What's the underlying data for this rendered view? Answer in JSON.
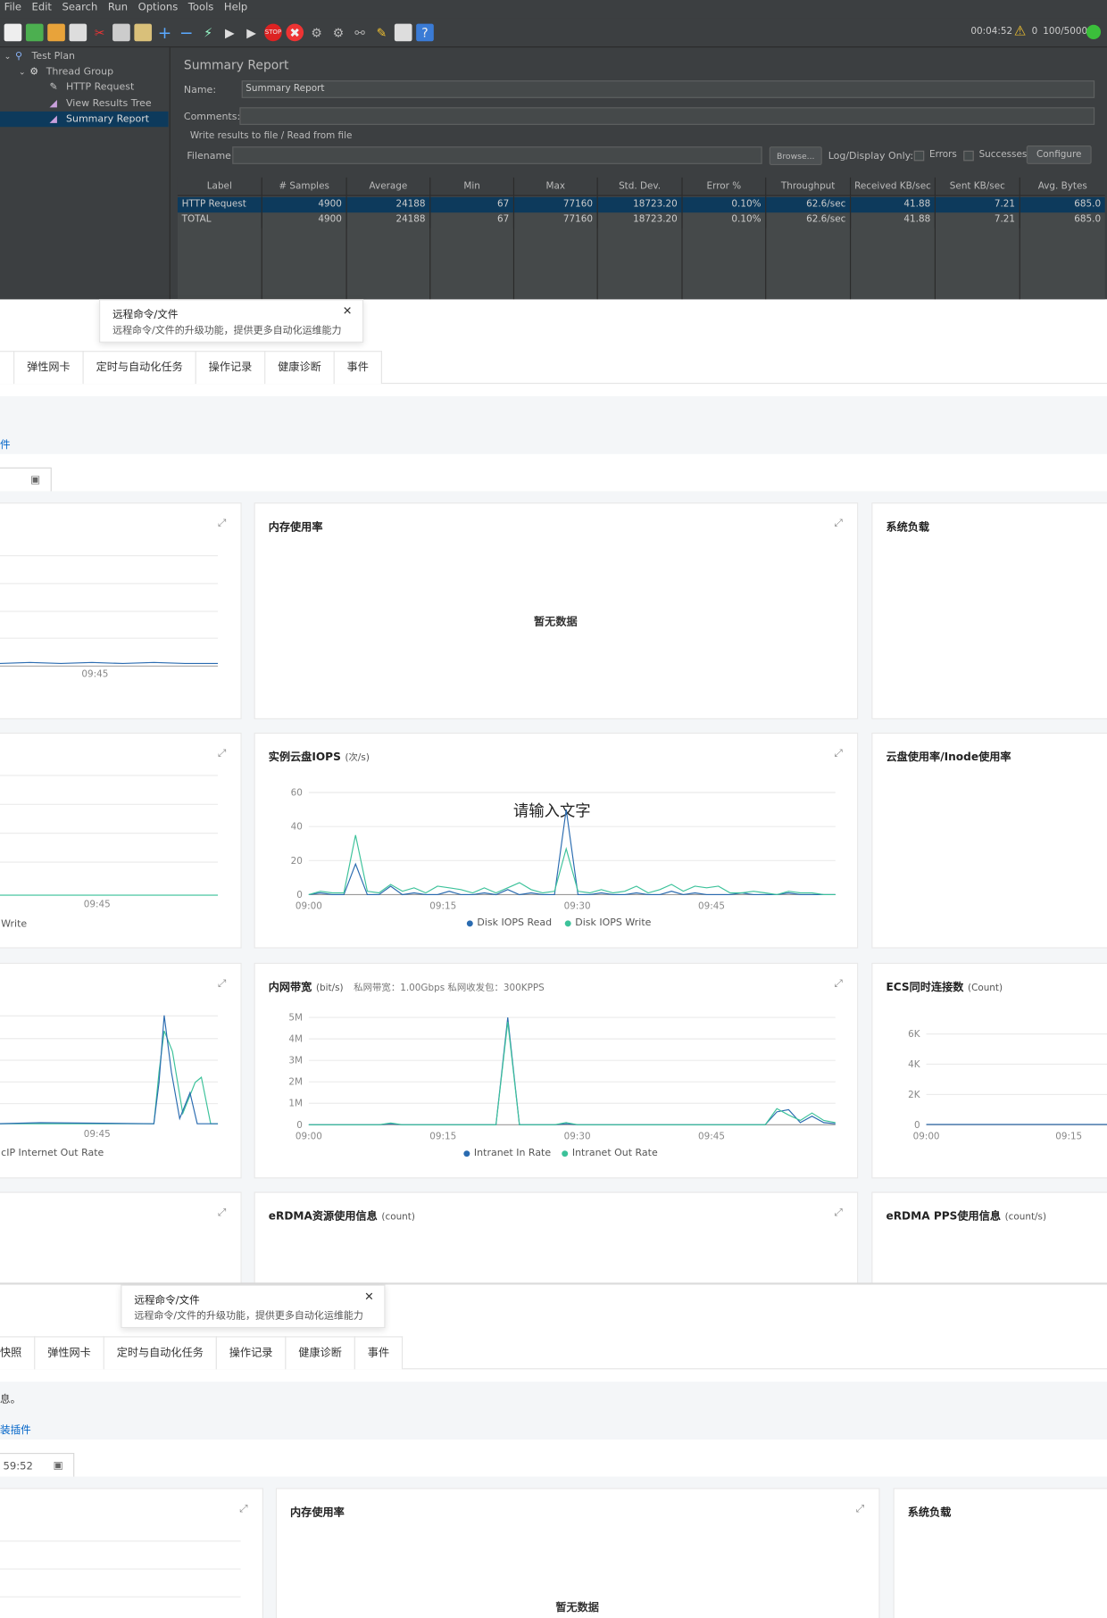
{
  "jmeter": {
    "menu": [
      "File",
      "Edit",
      "Search",
      "Run",
      "Options",
      "Tools",
      "Help"
    ],
    "status": {
      "elapsed": "00:04:52",
      "warnings": "0",
      "threads": "100/5000"
    },
    "tree": [
      "Test Plan",
      "Thread Group",
      "HTTP Request",
      "View Results Tree",
      "Summary Report"
    ],
    "panel_title": "Summary Report",
    "name_label": "Name:",
    "name_value": "Summary Report",
    "comments_label": "Comments:",
    "write_results": "Write results to file / Read from file",
    "filename_label": "Filename",
    "browse": "Browse...",
    "log_only": "Log/Display Only:",
    "errors": "Errors",
    "successes": "Successes",
    "configure": "Configure",
    "columns": [
      "Label",
      "# Samples",
      "Average",
      "Min",
      "Max",
      "Std. Dev.",
      "Error %",
      "Throughput",
      "Received KB/sec",
      "Sent KB/sec",
      "Avg. Bytes"
    ],
    "rows": [
      [
        "HTTP Request",
        "4900",
        "24188",
        "67",
        "77160",
        "18723.20",
        "0.10%",
        "62.6/sec",
        "41.88",
        "7.21",
        "685.0"
      ],
      [
        "TOTAL",
        "4900",
        "24188",
        "67",
        "77160",
        "18723.20",
        "0.10%",
        "62.6/sec",
        "41.88",
        "7.21",
        "685.0"
      ]
    ]
  },
  "console": {
    "tip_title": "远程命令/文件",
    "tip_desc": "远程命令/文件的升级功能，提供更多自动化运维能力",
    "tabs1": [
      "弹性网卡",
      "定时与自动化任务",
      "操作记录",
      "健康诊断",
      "事件"
    ],
    "tabs2": [
      "快照",
      "弹性网卡",
      "定时与自动化任务",
      "操作记录",
      "健康诊断",
      "事件"
    ],
    "link1": "件",
    "text2": "息。",
    "link2": "装插件",
    "date2": "59:52",
    "no_data": "暂无数据",
    "overlay_text": "请输入文字",
    "cards": {
      "mem": "内存使用率",
      "load": "系统负载",
      "iops": "实例云盘IOPS",
      "iops_unit": "(次/s)",
      "disk": "云盘使用率/Inode使用率",
      "net": "内网带宽",
      "net_unit": "(bit/s)",
      "net_note": "私网带宽：1.00Gbps 私网收发包：300KPPS",
      "conn": "ECS同时连接数",
      "conn_unit": "(Count)",
      "erdma": "eRDMA资源使用信息",
      "erdma_unit": "(count)",
      "erdma_pps": "eRDMA PPS使用信息",
      "erdma_pps_unit": "(count/s)"
    },
    "left_partial": {
      "tick": "09:45",
      "legend_write": "Write",
      "legend_out": "cIP Internet Out Rate"
    },
    "colors": {
      "series_blue": "#2a6bb0",
      "series_green": "#3cc29a",
      "link": "#0064c8"
    }
  },
  "chart_data": [
    {
      "type": "line",
      "title": "实例云盘IOPS",
      "ylabel": "(次/s)",
      "x": [
        "09:00",
        "09:15",
        "09:30",
        "09:45"
      ],
      "ylim": [
        0,
        60
      ],
      "yticks": [
        0,
        20,
        40,
        60
      ],
      "series": [
        {
          "name": "Disk IOPS Read",
          "color": "#2a6bb0",
          "values": [
            0,
            1,
            0,
            0,
            18,
            0,
            0,
            5,
            0,
            1,
            0,
            0,
            2,
            0,
            0,
            1,
            0,
            3,
            0,
            1,
            0,
            0,
            50,
            0,
            0,
            1,
            0,
            0,
            1,
            0,
            0,
            2,
            0,
            1,
            0,
            0,
            0,
            1,
            0,
            0,
            0,
            1,
            0,
            0,
            0,
            0
          ]
        },
        {
          "name": "Disk IOPS Write",
          "color": "#3cc29a",
          "values": [
            0,
            2,
            1,
            1,
            35,
            2,
            1,
            6,
            2,
            4,
            1,
            5,
            4,
            3,
            1,
            4,
            1,
            4,
            7,
            3,
            1,
            2,
            27,
            2,
            1,
            3,
            1,
            2,
            5,
            1,
            3,
            6,
            2,
            5,
            4,
            5,
            1,
            1,
            2,
            1,
            0,
            2,
            1,
            1,
            0,
            0
          ]
        }
      ]
    },
    {
      "type": "line",
      "title": "内网带宽",
      "ylabel": "(bit/s)",
      "x": [
        "09:00",
        "09:15",
        "09:30",
        "09:45"
      ],
      "ylim": [
        0,
        5000000
      ],
      "yticks": [
        "0",
        "1M",
        "2M",
        "3M",
        "4M",
        "5M"
      ],
      "series": [
        {
          "name": "Intranet In Rate",
          "color": "#2a6bb0",
          "values": [
            0,
            0,
            0,
            0,
            0,
            0,
            0,
            0.05,
            0,
            0,
            0,
            0,
            0,
            0,
            0,
            0,
            0,
            5,
            0,
            0,
            0,
            0,
            0.05,
            0,
            0,
            0,
            0,
            0,
            0,
            0,
            0,
            0,
            0,
            0,
            0,
            0,
            0,
            0,
            0,
            0,
            0.6,
            0.7,
            0.1,
            0.4,
            0.1,
            0.05
          ]
        },
        {
          "name": "Intranet Out Rate",
          "color": "#3cc29a",
          "values": [
            0,
            0,
            0,
            0,
            0,
            0,
            0,
            0.08,
            0,
            0,
            0,
            0,
            0,
            0,
            0,
            0,
            0,
            4.8,
            0,
            0,
            0,
            0,
            0.1,
            0,
            0,
            0,
            0,
            0,
            0,
            0,
            0,
            0,
            0,
            0,
            0,
            0,
            0,
            0,
            0,
            0,
            0.75,
            0.45,
            0.2,
            0.55,
            0.2,
            0.1
          ]
        }
      ]
    },
    {
      "type": "line",
      "title": "ECS同时连接数",
      "ylabel": "(Count)",
      "x": [
        "09:00",
        "09:15"
      ],
      "ylim": [
        0,
        6000
      ],
      "yticks": [
        "0",
        "2K",
        "4K",
        "6K"
      ],
      "series": [
        {
          "color": "#2a6bb0",
          "values": [
            20,
            20,
            20,
            20,
            20,
            20,
            20,
            20,
            20,
            20,
            20,
            20
          ]
        }
      ]
    }
  ]
}
